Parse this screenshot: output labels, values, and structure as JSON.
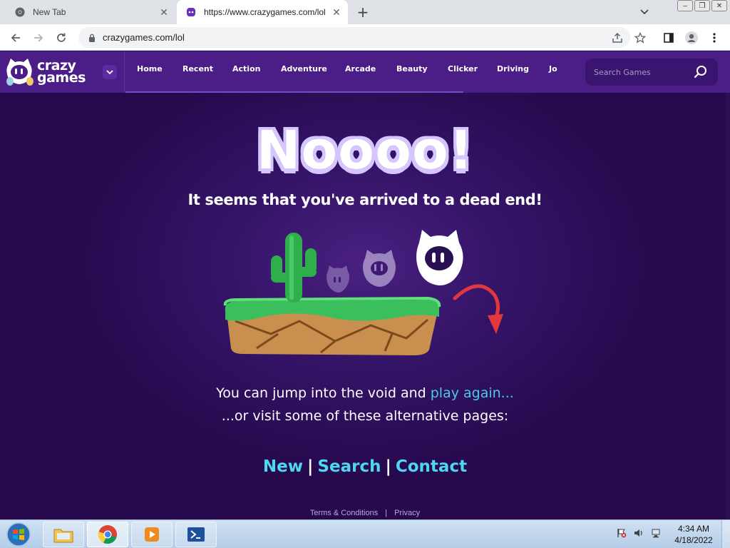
{
  "browser": {
    "tabs": [
      {
        "title": "New Tab",
        "icon": "chrome-icon",
        "active": false
      },
      {
        "title": "https://www.crazygames.com/lol",
        "icon": "crazygames-icon",
        "active": true
      }
    ],
    "url": "crazygames.com/lol"
  },
  "site": {
    "logo": {
      "line1": "crazy",
      "line2": "games"
    },
    "nav": [
      "Home",
      "Recent",
      "Action",
      "Adventure",
      "Arcade",
      "Beauty",
      "Clicker",
      "Driving",
      "Jo"
    ],
    "search_placeholder": "Search Games"
  },
  "error_page": {
    "headline": "Noooo!",
    "subheadline": "It seems that you've arrived to a dead end!",
    "message_prefix": "You can jump into the void and ",
    "play_again_link": "play again...",
    "message_line2": "...or visit some of these alternative pages:",
    "links": [
      "New",
      "Search",
      "Contact"
    ]
  },
  "footer": {
    "terms": "Terms & Conditions",
    "privacy": "Privacy"
  },
  "taskbar": {
    "time": "4:34 AM",
    "date": "4/18/2022"
  },
  "colors": {
    "header_bg": "#4a1d87",
    "page_bg": "#2a0f52",
    "link_cyan": "#4ed8ef"
  }
}
